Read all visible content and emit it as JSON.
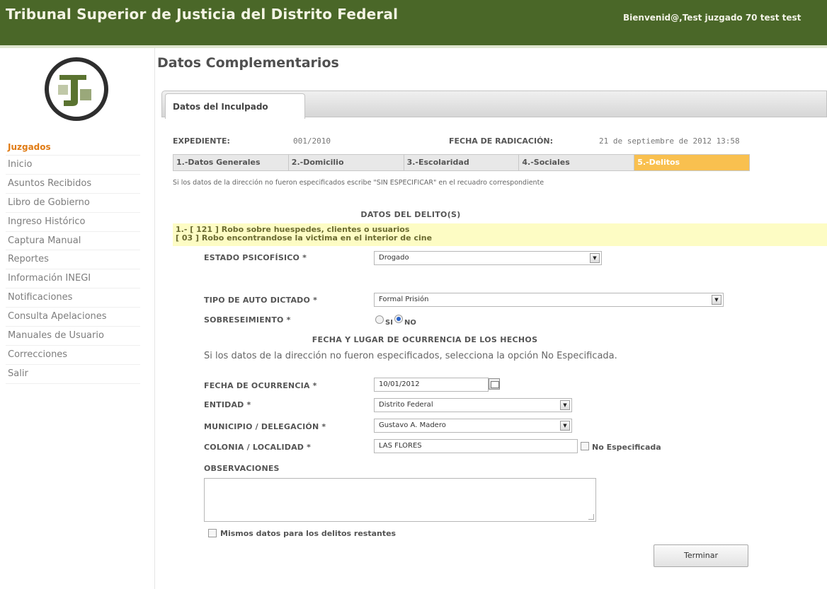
{
  "header": {
    "title": "Tribunal Superior de Justicia del Distrito Federal",
    "welcome": "Bienvenid@,Test juzgado 70 test  test"
  },
  "sidebar": {
    "section": "Juzgados",
    "items": [
      {
        "label": "Inicio"
      },
      {
        "label": "Asuntos Recibidos"
      },
      {
        "label": "Libro de Gobierno"
      },
      {
        "label": "Ingreso Histórico"
      },
      {
        "label": "Captura Manual"
      },
      {
        "label": "Reportes"
      },
      {
        "label": "Información INEGI"
      },
      {
        "label": "Notificaciones"
      },
      {
        "label": "Consulta Apelaciones"
      },
      {
        "label": "Manuales de Usuario"
      },
      {
        "label": "Correcciones"
      },
      {
        "label": "Salir"
      }
    ]
  },
  "main": {
    "title": "Datos Complementarios",
    "tab": "Datos del Inculpado",
    "expediente_label": "EXPEDIENTE:",
    "expediente_value": "001/2010",
    "fecha_label": "FECHA DE RADICACIÓN:",
    "fecha_value": "21 de septiembre de 2012 13:58",
    "steps": [
      {
        "label": "1.-Datos Generales"
      },
      {
        "label": "2.-Domicilio"
      },
      {
        "label": "3.-Escolaridad"
      },
      {
        "label": "4.-Sociales"
      },
      {
        "label": "5.-Delitos"
      }
    ],
    "active_step": 5,
    "note": "Si los datos de la dirección no fueron especificados escribe \"SIN ESPECIFICAR\" en el recuadro correspondiente",
    "delitos_title": "DATOS DEL DELITO(S)",
    "delito_line1": "1.-  [ 121 ] Robo sobre huespedes, clientes o usuarios",
    "delito_line2": " [ 03 ] Robo encontrandose la victima en el interior de cine"
  },
  "form": {
    "estado_label": "ESTADO PSICOFÍSICO *",
    "estado_value": "Drogado",
    "tipo_auto_label": "TIPO DE AUTO DICTADO *",
    "tipo_auto_value": "Formal Prisión",
    "sobreseimiento_label": "SOBRESEIMIENTO *",
    "radio_si": "SI",
    "radio_no": "NO",
    "sobreseimiento_selected": "NO",
    "fecha_lugar_title": "FECHA Y LUGAR DE OCURRENCIA DE LOS HECHOS",
    "info_text": "Si los datos de la dirección no fueron especificados, selecciona la opción No Especificada.",
    "fecha_ocurrencia_label": "FECHA DE OCURRENCIA *",
    "fecha_ocurrencia_value": "10/01/2012",
    "entidad_label": "ENTIDAD *",
    "entidad_value": "Distrito Federal",
    "municipio_label": "MUNICIPIO / DELEGACIÓN *",
    "municipio_value": "Gustavo A. Madero",
    "colonia_label": "COLONIA / LOCALIDAD *",
    "colonia_value": "LAS FLORES",
    "no_especificada": "No Especificada",
    "observaciones_label": "OBSERVACIONES",
    "observaciones_value": "",
    "mismos_datos": "Mismos datos para los delitos restantes",
    "terminar": "Terminar"
  },
  "colors": {
    "header_bg": "#4a6728",
    "accent_orange": "#e07b14",
    "active_step": "#f9c04f",
    "delito_highlight": "#fdfcc4"
  }
}
